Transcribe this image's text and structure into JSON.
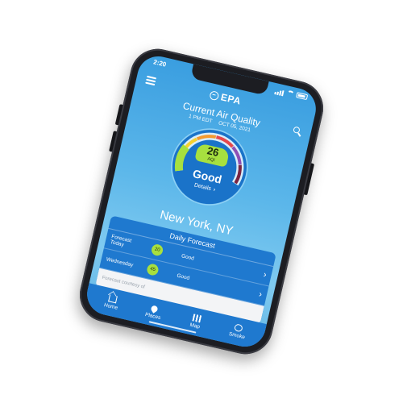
{
  "status_bar": {
    "time": "2:20"
  },
  "header": {
    "logo_text": "EPA",
    "menu_icon": "hamburger-icon",
    "search_icon": "search-icon"
  },
  "title": {
    "text": "Current Air Quality",
    "time": "1 PM EDT",
    "date": "OCT 05, 2021"
  },
  "aqi": {
    "value": "26",
    "unit": "AQI",
    "category": "Good",
    "details_label": "Details",
    "level_fraction": 0.09,
    "colors": {
      "good": "#a7e03f",
      "moderate": "#f6d12e",
      "usg": "#f39a2f",
      "unhealthy": "#e5484d",
      "very_unhealthy": "#8e4fb5",
      "hazardous": "#7a2442"
    }
  },
  "location": {
    "city": "New York, NY"
  },
  "forecast": {
    "heading": "Daily Forecast",
    "rows": [
      {
        "day_line1": "Forecast",
        "day_line2": "Today",
        "aqi": "20",
        "category": "Good"
      },
      {
        "day_line1": "Wednesday",
        "day_line2": "",
        "aqi": "45",
        "category": "Good"
      }
    ],
    "courtesy": "Forecast courtesy of"
  },
  "tabs": [
    {
      "label": "Home",
      "icon": "home-icon"
    },
    {
      "label": "Places",
      "icon": "places-icon"
    },
    {
      "label": "Map",
      "icon": "map-icon"
    },
    {
      "label": "Smoke",
      "icon": "smoke-icon"
    }
  ],
  "colors": {
    "screen_top": "#3a9ee0",
    "panel": "#1f79cf",
    "good": "#a7e03f"
  }
}
